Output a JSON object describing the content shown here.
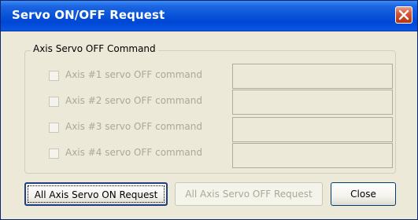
{
  "window": {
    "title": "Servo ON/OFF Request"
  },
  "group": {
    "legend": "Axis Servo OFF Command",
    "rows": [
      {
        "label": "Axis #1 servo OFF command",
        "checked": false,
        "enabled": false,
        "value": ""
      },
      {
        "label": "Axis #2 servo OFF command",
        "checked": false,
        "enabled": false,
        "value": ""
      },
      {
        "label": "Axis #3 servo OFF command",
        "checked": false,
        "enabled": false,
        "value": ""
      },
      {
        "label": "Axis #4 servo OFF command",
        "checked": false,
        "enabled": false,
        "value": ""
      }
    ]
  },
  "buttons": {
    "all_on": "All Axis Servo ON Request",
    "all_off": "All Axis Servo OFF Request",
    "close": "Close"
  },
  "colors": {
    "titlebar": "#0a54d8",
    "dialog_bg": "#ece9d8",
    "disabled_text": "#aca899",
    "close_button": "#c9411f"
  },
  "icons": {
    "close": "close-icon"
  }
}
